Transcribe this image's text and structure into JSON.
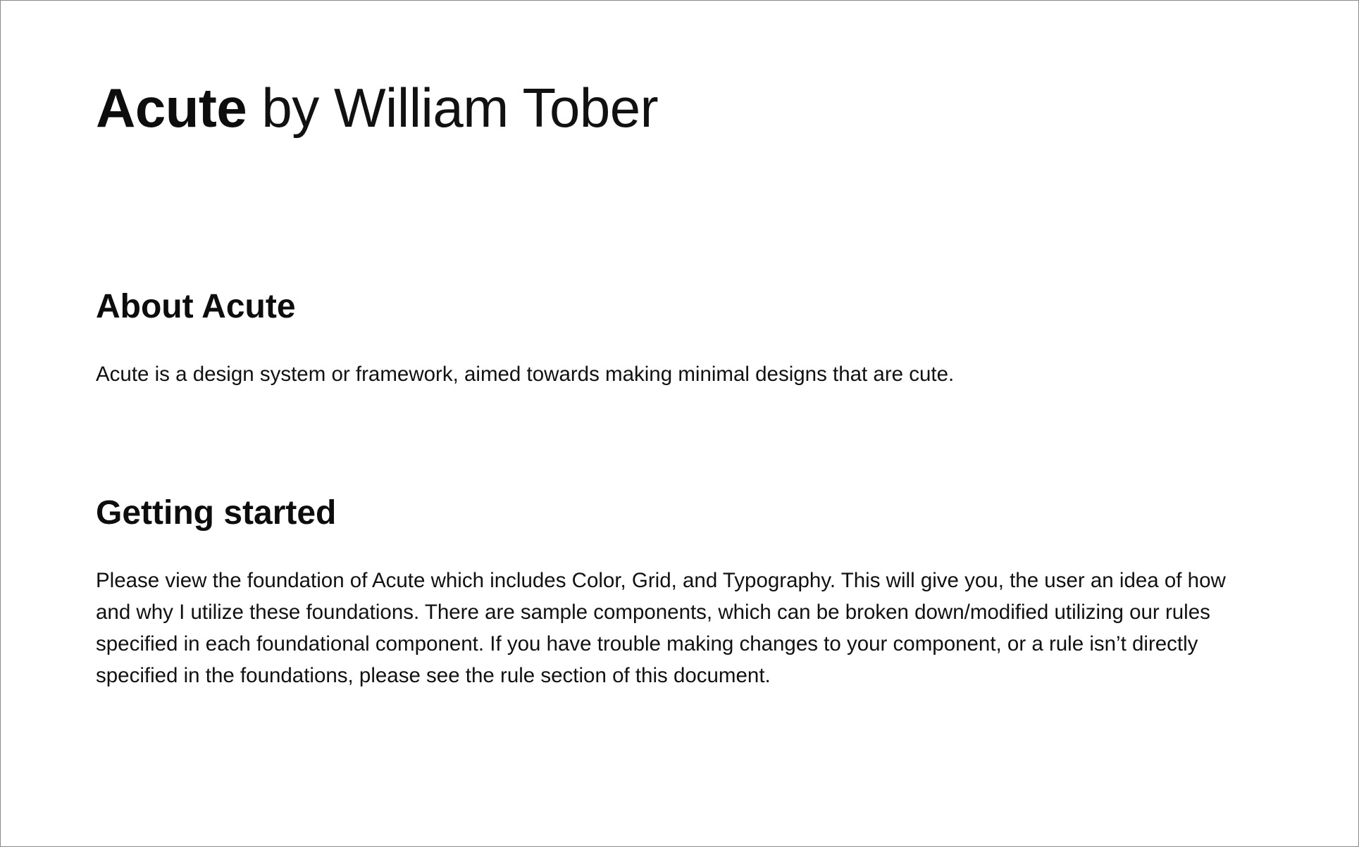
{
  "header": {
    "brand": "Acute",
    "byline": "by William Tober"
  },
  "sections": [
    {
      "heading": "About Acute",
      "body": "Acute is a design system or framework, aimed towards making minimal designs that are cute."
    },
    {
      "heading": "Getting started",
      "body": "Please view the foundation of Acute which includes Color, Grid, and Typography. This will give you, the user an idea of how and why I utilize these foundations. There are sample components, which can be broken down/modified utilizing our rules specified in each foundational component. If you have trouble making changes to your component, or a rule isn’t directly specified in the foundations, please see the rule section of this document."
    }
  ],
  "colors": {
    "text": "#0d0d0d",
    "background": "#ffffff",
    "border": "#8a8a8a"
  }
}
